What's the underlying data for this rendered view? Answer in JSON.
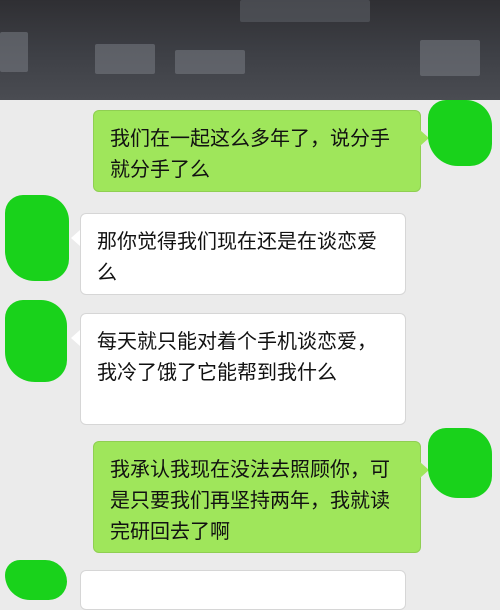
{
  "header": {
    "title": ""
  },
  "messages": [
    {
      "side": "out",
      "text": "我们在一起这么多年了，说分手就分手了么"
    },
    {
      "side": "in",
      "text": "那你觉得我们现在还是在谈恋爱么"
    },
    {
      "side": "in",
      "text": "每天就只能对着个手机谈恋爱，我冷了饿了它能帮到我什么"
    },
    {
      "side": "out",
      "text": "我承认我现在没法去照顾你，可是只要我们再坚持两年，我就读完研回去了啊"
    },
    {
      "side": "in",
      "text": ""
    }
  ],
  "colors": {
    "outgoing_bubble": "#9fe65b",
    "incoming_bubble": "#ffffff",
    "avatar_overlay": "#19d21b",
    "chat_background": "#ebebeb"
  }
}
